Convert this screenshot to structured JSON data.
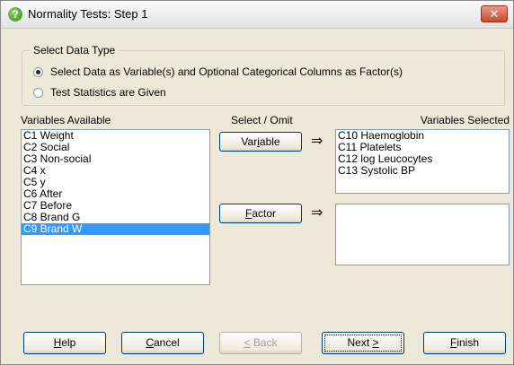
{
  "window": {
    "title": "Normality Tests: Step 1",
    "close_glyph": "✕"
  },
  "data_type": {
    "legend": "Select Data Type",
    "option_variables": "Select Data as Variable(s) and Optional Categorical Columns as Factor(s)",
    "option_statistics": "Test Statistics are Given",
    "selected": "option_variables"
  },
  "headers": {
    "available": "Variables Available",
    "select_omit": "Select / Omit",
    "selected": "Variables Selected"
  },
  "available": {
    "items": [
      "C1 Weight",
      "C2 Social",
      "C3 Non-social",
      "C4 x",
      "C5 y",
      "C6 After",
      "C7 Before",
      "C8 Brand G",
      "C9 Brand W"
    ],
    "selected_index": 8
  },
  "buttons": {
    "variable": {
      "pre": "Var",
      "u": "i",
      "post": "able"
    },
    "factor": {
      "pre": "",
      "u": "F",
      "post": "actor"
    },
    "help": {
      "pre": "",
      "u": "H",
      "post": "elp"
    },
    "cancel": {
      "pre": "",
      "u": "C",
      "post": "ancel"
    },
    "back": {
      "pre": "",
      "u": "<",
      "post": " Back"
    },
    "next": {
      "pre": "Next ",
      "u": ">",
      "post": ""
    },
    "finish": {
      "pre": "",
      "u": "F",
      "post": "inish"
    }
  },
  "arrow_glyph": "⇒",
  "selected_variables": [
    "C10 Haemoglobin",
    "C11 Platelets",
    "C12 log Leucocytes",
    "C13 Systolic BP"
  ],
  "selected_factors": []
}
